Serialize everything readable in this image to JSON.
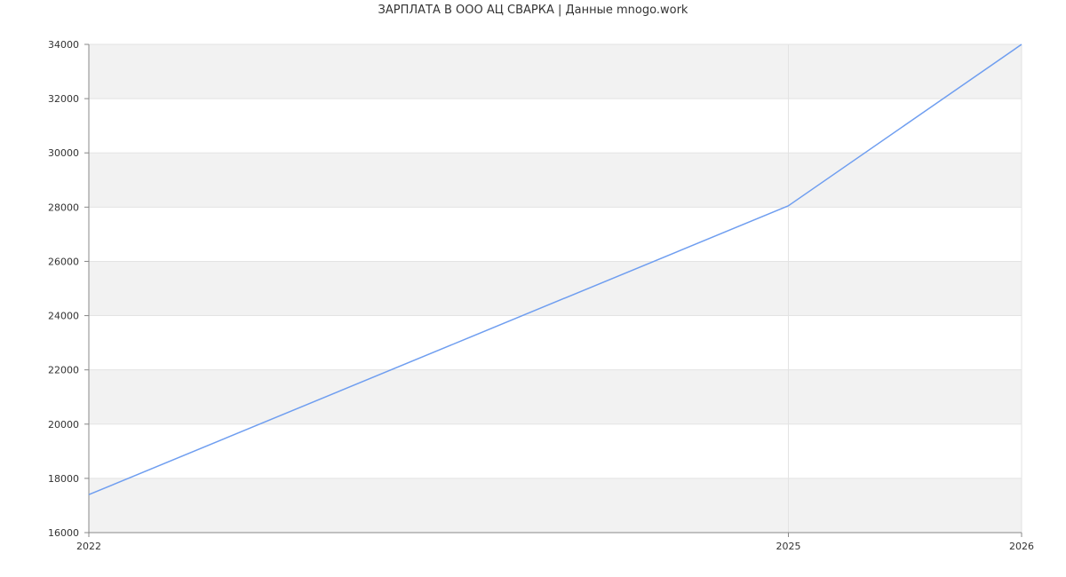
{
  "chart_data": {
    "type": "line",
    "title": "ЗАРПЛАТА В ООО АЦ СВАРКА | Данные mnogo.work",
    "xlabel": "",
    "ylabel": "",
    "x": [
      "2022",
      "2025",
      "2026"
    ],
    "x_values": [
      2022,
      2025,
      2026
    ],
    "xlim": [
      2022,
      2026
    ],
    "ylim": [
      16000,
      34000
    ],
    "y_ticks": [
      "16000",
      "18000",
      "20000",
      "22000",
      "24000",
      "26000",
      "28000",
      "30000",
      "32000",
      "34000"
    ],
    "series": [
      {
        "values": [
          17400,
          28050,
          34000
        ]
      }
    ],
    "grid": true,
    "legend": "none",
    "colors": {
      "line": "#6f9ef0",
      "band": "#f2f2f2",
      "grid": "#e3e3e3",
      "axis": "#888888"
    }
  }
}
